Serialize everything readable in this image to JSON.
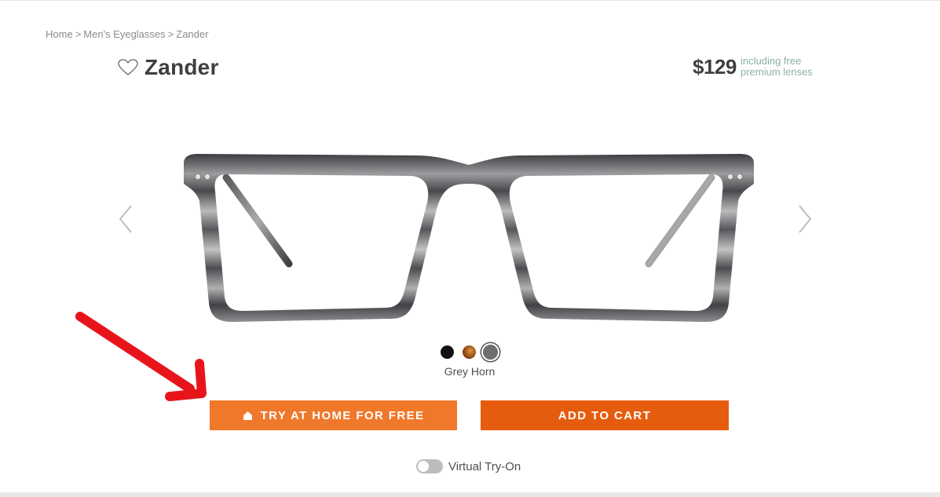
{
  "breadcrumb": [
    {
      "label": "Home"
    },
    {
      "label": "Men's Eyeglasses"
    },
    {
      "label": "Zander"
    }
  ],
  "breadcrumb_separator": ">",
  "product": {
    "name": "Zander",
    "price": "$129",
    "price_note": "including free premium lenses"
  },
  "colors": {
    "selected_name": "Grey Horn",
    "swatches": [
      {
        "name": "black",
        "hex": "#111111"
      },
      {
        "name": "tortoise",
        "hex": "#a85a1e"
      },
      {
        "name": "grey-horn",
        "hex": "#6e6e6e",
        "selected": true
      }
    ]
  },
  "actions": {
    "try_at_home_label": "TRY AT HOME FOR FREE",
    "add_to_cart_label": "ADD TO CART"
  },
  "virtual_try_on": {
    "label": "Virtual Try-On",
    "enabled": false
  },
  "theme": {
    "try_button_color": "#f0782a",
    "cart_button_color": "#e65c0e",
    "annotation_arrow_color": "#e8141b"
  },
  "icons": [
    "heart-icon",
    "chevron-left-icon",
    "chevron-right-icon",
    "house-icon"
  ]
}
